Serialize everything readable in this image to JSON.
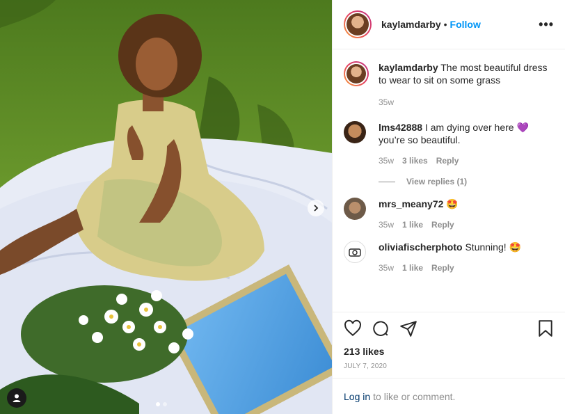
{
  "post": {
    "username": "kaylamdarby",
    "separator": "•",
    "follow_label": "Follow",
    "more_icon": "•••"
  },
  "caption": {
    "username": "kaylamdarby",
    "text": "The most beautiful dress to wear to sit on some grass",
    "time": "35w"
  },
  "comments": [
    {
      "username": "lms42888",
      "text": "I am dying over here 💜 you’re so beautiful.",
      "time": "35w",
      "likes": "3 likes",
      "reply": "Reply",
      "view_replies": "View replies (1)"
    },
    {
      "username": "mrs_meany72",
      "text": "🤩",
      "time": "35w",
      "likes": "1 like",
      "reply": "Reply"
    },
    {
      "username": "oliviafischerphoto",
      "text": "Stunning! 🤩",
      "time": "35w",
      "likes": "1 like",
      "reply": "Reply"
    }
  ],
  "actions": {
    "likes": "213 likes",
    "date": "JULY 7, 2020"
  },
  "login": {
    "link": "Log in",
    "text": "to like or comment."
  },
  "colors": {
    "follow": "#0095f6",
    "link": "#00376b",
    "muted": "#8e8e8e"
  }
}
